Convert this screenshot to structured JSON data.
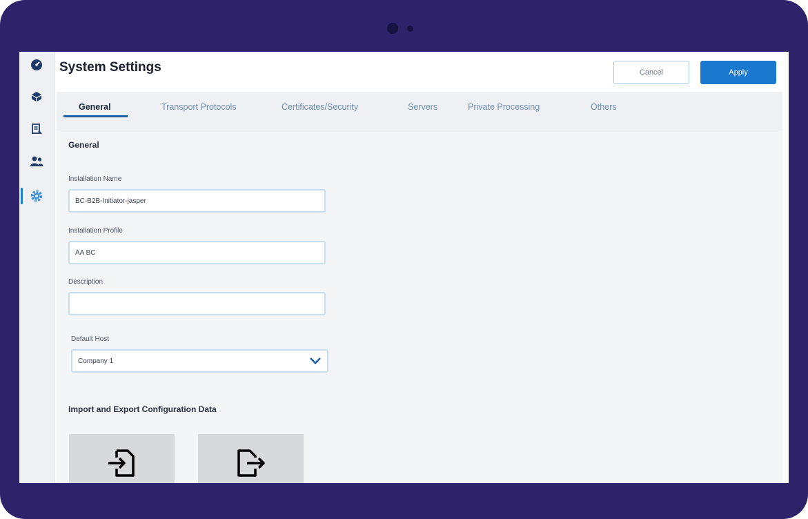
{
  "window": {
    "title": "System Settings",
    "cancel_label": "Cancel",
    "apply_label": "Apply"
  },
  "sidebar": {
    "items": [
      {
        "icon": "dashboard-icon",
        "active": false
      },
      {
        "icon": "box-icon",
        "active": false
      },
      {
        "icon": "report-icon",
        "active": false
      },
      {
        "icon": "users-icon",
        "active": false
      },
      {
        "icon": "gear-icon",
        "active": true
      }
    ]
  },
  "tabs": [
    {
      "label": "General",
      "active": true
    },
    {
      "label": "Transport Protocols",
      "active": false
    },
    {
      "label": "Certificates/Security",
      "active": false
    },
    {
      "label": "Servers",
      "active": false
    },
    {
      "label": "Private Processing",
      "active": false
    },
    {
      "label": "Others",
      "active": false
    }
  ],
  "general": {
    "heading": "General",
    "installation_name": {
      "label": "Installation Name",
      "value": "BC-B2B-Initiator-jasper"
    },
    "installation_profile": {
      "label": "Installation Profile",
      "value": "AA BC"
    },
    "description": {
      "label": "Description",
      "value": ""
    },
    "default_host": {
      "label": "Default Host",
      "value": "Company 1"
    }
  },
  "import_export": {
    "heading": "Import and Export Configuration Data",
    "import_icon": "import-file-icon",
    "export_icon": "export-file-icon"
  },
  "colors": {
    "bezel": "#2e236b",
    "accent": "#1a78cf",
    "active_tab_underline": "#1f5fa5"
  }
}
